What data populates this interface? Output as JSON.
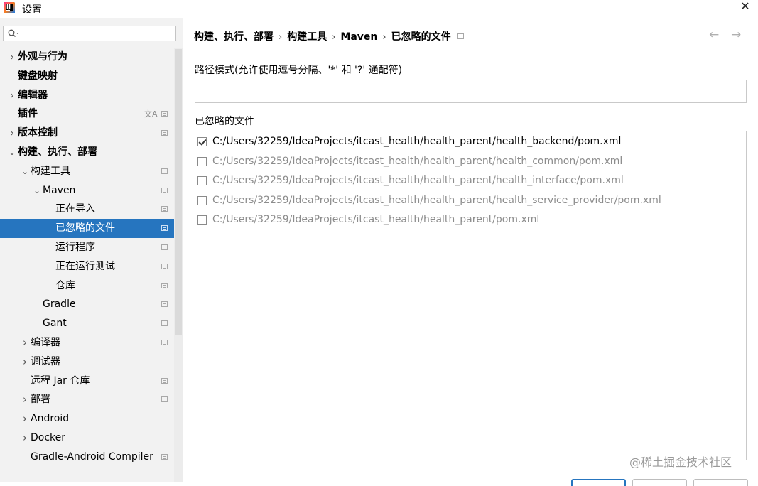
{
  "window": {
    "title": "设置",
    "close_glyph": "✕"
  },
  "search": {
    "placeholder": "",
    "value": ""
  },
  "sidebar": {
    "items": [
      {
        "label": "外观与行为",
        "arrow": "›",
        "bold": true,
        "indent": 0,
        "icon": ""
      },
      {
        "label": "键盘映射",
        "arrow": "",
        "bold": true,
        "indent": 0,
        "icon": ""
      },
      {
        "label": "编辑器",
        "arrow": "›",
        "bold": true,
        "indent": 0,
        "icon": ""
      },
      {
        "label": "插件",
        "arrow": "",
        "bold": true,
        "indent": 0,
        "icon": "translate-icon"
      },
      {
        "label": "版本控制",
        "arrow": "›",
        "bold": true,
        "indent": 0,
        "icon": "project-scope-icon"
      },
      {
        "label": "构建、执行、部署",
        "arrow": "⌄",
        "bold": true,
        "indent": 0,
        "icon": ""
      },
      {
        "label": "构建工具",
        "arrow": "⌄",
        "bold": false,
        "indent": 1,
        "icon": "project-scope-icon"
      },
      {
        "label": "Maven",
        "arrow": "⌄",
        "bold": false,
        "indent": 2,
        "icon": "project-scope-icon"
      },
      {
        "label": "正在导入",
        "arrow": "",
        "bold": false,
        "indent": 3,
        "icon": "project-scope-icon"
      },
      {
        "label": "已忽略的文件",
        "arrow": "",
        "bold": false,
        "indent": 3,
        "icon": "project-scope-icon",
        "selected": true
      },
      {
        "label": "运行程序",
        "arrow": "",
        "bold": false,
        "indent": 3,
        "icon": "project-scope-icon"
      },
      {
        "label": "正在运行测试",
        "arrow": "",
        "bold": false,
        "indent": 3,
        "icon": "project-scope-icon"
      },
      {
        "label": "仓库",
        "arrow": "",
        "bold": false,
        "indent": 3,
        "icon": "project-scope-icon"
      },
      {
        "label": "Gradle",
        "arrow": "",
        "bold": false,
        "indent": 2,
        "icon": "project-scope-icon"
      },
      {
        "label": "Gant",
        "arrow": "",
        "bold": false,
        "indent": 2,
        "icon": "project-scope-icon"
      },
      {
        "label": "编译器",
        "arrow": "›",
        "bold": false,
        "indent": 1,
        "icon": "project-scope-icon"
      },
      {
        "label": "调试器",
        "arrow": "›",
        "bold": false,
        "indent": 1,
        "icon": ""
      },
      {
        "label": "远程 Jar 仓库",
        "arrow": "",
        "bold": false,
        "indent": 1,
        "icon": "project-scope-icon"
      },
      {
        "label": "部署",
        "arrow": "›",
        "bold": false,
        "indent": 1,
        "icon": "project-scope-icon"
      },
      {
        "label": "Android",
        "arrow": "›",
        "bold": false,
        "indent": 1,
        "icon": ""
      },
      {
        "label": "Docker",
        "arrow": "›",
        "bold": false,
        "indent": 1,
        "icon": ""
      },
      {
        "label": "Gradle-Android Compiler",
        "arrow": "",
        "bold": false,
        "indent": 1,
        "icon": "project-scope-icon"
      }
    ]
  },
  "breadcrumb": {
    "items": [
      "构建、执行、部署",
      "构建工具",
      "Maven",
      "已忽略的文件"
    ],
    "separator": "›"
  },
  "nav": {
    "back": "←",
    "forward": "→"
  },
  "form": {
    "pattern_label": "路径模式(允许使用逗号分隔、'*' 和 '?' 通配符)",
    "pattern_value": "",
    "ignored_label": "已忽略的文件",
    "files": [
      {
        "path": "C:/Users/32259/IdeaProjects/itcast_health/health_parent/health_backend/pom.xml",
        "checked": true
      },
      {
        "path": "C:/Users/32259/IdeaProjects/itcast_health/health_parent/health_common/pom.xml",
        "checked": false
      },
      {
        "path": "C:/Users/32259/IdeaProjects/itcast_health/health_parent/health_interface/pom.xml",
        "checked": false
      },
      {
        "path": "C:/Users/32259/IdeaProjects/itcast_health/health_parent/health_service_provider/pom.xml",
        "checked": false
      },
      {
        "path": "C:/Users/32259/IdeaProjects/itcast_health/health_parent/pom.xml",
        "checked": false
      }
    ]
  },
  "watermark": "@稀土掘金技术社区",
  "colors": {
    "selection": "#2675bf",
    "sidebar_bg": "#f2f2f2",
    "dim_text": "#8c8c8c"
  }
}
